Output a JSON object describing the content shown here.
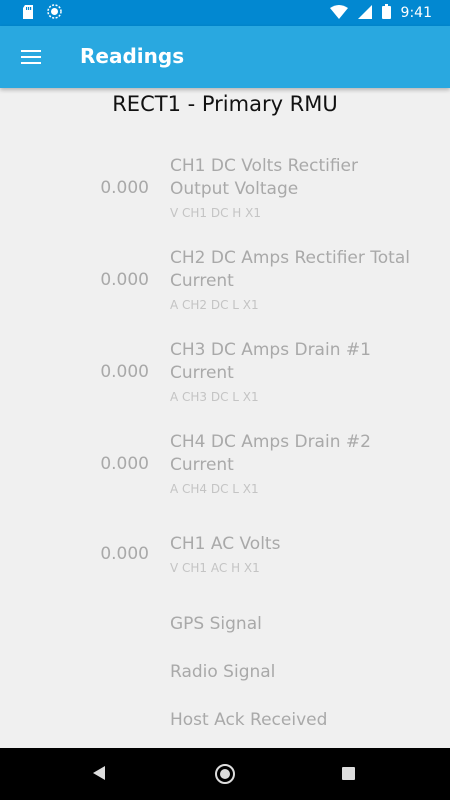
{
  "status_bar": {
    "time": "9:41",
    "icons": [
      "sd-card-icon",
      "sync-icon",
      "wifi-icon",
      "cellular-icon",
      "battery-icon"
    ]
  },
  "app_bar": {
    "title": "Readings",
    "menu_icon": "hamburger-menu-icon",
    "background": "#29a8e0"
  },
  "device_title": "RECT1 - Primary RMU",
  "readings": [
    {
      "value": "0.000",
      "name": "CH1 DC Volts Rectifier Output Voltage",
      "unit": "V CH1 DC H X1"
    },
    {
      "value": "0.000",
      "name": "CH2 DC Amps Rectifier Total Current",
      "unit": "A CH2 DC L X1"
    },
    {
      "value": "0.000",
      "name": "CH3 DC Amps Drain #1 Current",
      "unit": "A CH3 DC L X1"
    },
    {
      "value": "0.000",
      "name": "CH4 DC Amps Drain #2 Current",
      "unit": "A CH4 DC L X1"
    },
    {
      "value": "0.000",
      "name": "CH1 AC Volts",
      "unit": "V CH1 AC H X1"
    }
  ],
  "signals": [
    {
      "name": "GPS Signal"
    },
    {
      "name": "Radio Signal"
    },
    {
      "name": "Host Ack Received"
    }
  ],
  "nav_bar": {
    "icons": [
      "back-icon",
      "home-icon",
      "recent-apps-icon"
    ]
  }
}
